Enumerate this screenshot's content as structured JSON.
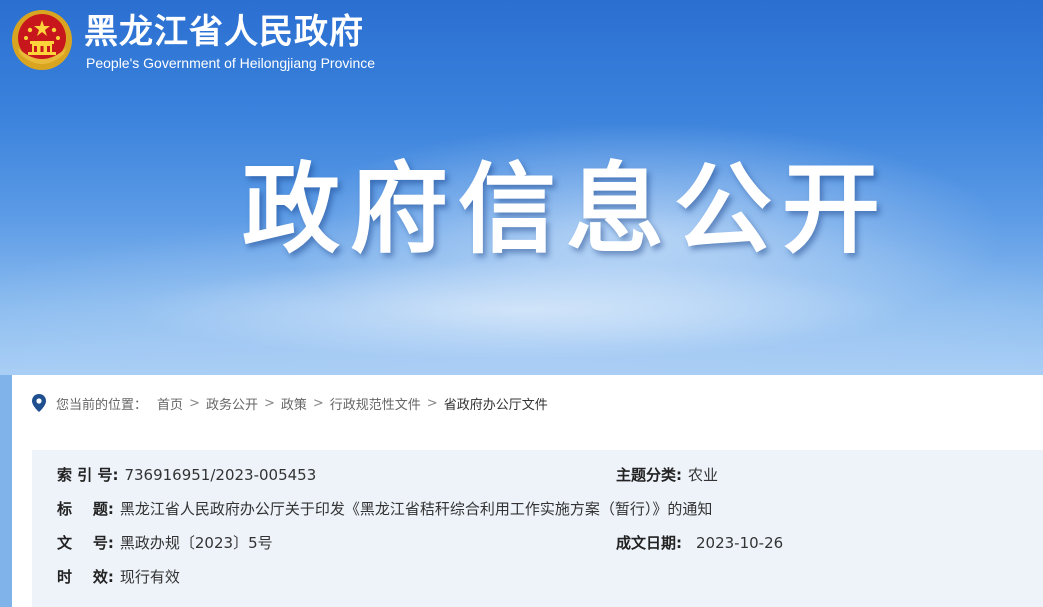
{
  "header": {
    "site_title": "黑龙江省人民政府",
    "site_subtitle": "People's Government of Heilongjiang Province",
    "hero_title": "政府信息公开"
  },
  "breadcrumb": {
    "lead": "您当前的位置：",
    "items": [
      "首页",
      "政务公开",
      "政策",
      "行政规范性文件",
      "省政府办公厅文件"
    ],
    "separator": ">"
  },
  "meta": {
    "index_no": {
      "label": "索 引 号:",
      "value": "736916951/2023-005453"
    },
    "topic": {
      "label": "主题分类:",
      "value": "农业"
    },
    "title": {
      "label": "标    题:",
      "value": "黑龙江省人民政府办公厅关于印发《黑龙江省秸秆综合利用工作实施方案（暂行）》的通知"
    },
    "doc_no": {
      "label": "文    号:",
      "value": "黑政办规〔2023〕5号"
    },
    "date": {
      "label": "成文日期:",
      "value": "2023-10-26"
    },
    "validity": {
      "label": "时    效:",
      "value": "现行有效"
    }
  },
  "colors": {
    "banner_top": "#2b6fd1",
    "banner_bottom": "#a9cff5",
    "meta_bg": "#eef3fa",
    "pin": "#1f4f8f"
  },
  "icons": [
    "national-emblem-icon",
    "location-pin-icon"
  ]
}
